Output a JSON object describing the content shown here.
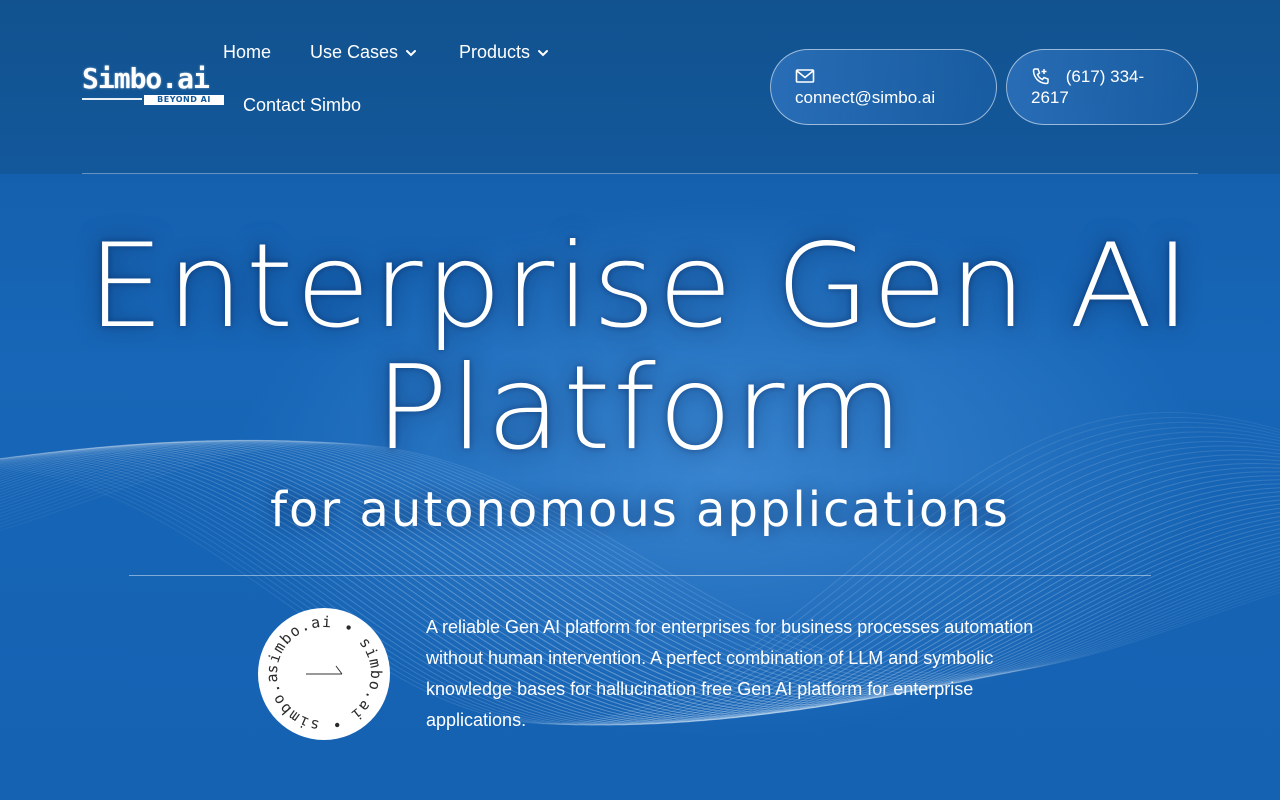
{
  "logo": {
    "wordmark": "Simbo.ai",
    "tagline": "BEYOND AI"
  },
  "nav": {
    "home": "Home",
    "use_cases": "Use Cases",
    "products": "Products",
    "contact": "Contact Simbo"
  },
  "contact": {
    "email": "connect@simbo.ai",
    "phone_line1": "(617) 334-",
    "phone_line2": "2617",
    "email_icon": "envelope-icon",
    "phone_icon": "phone-icon"
  },
  "hero": {
    "title_line1": "Enterprise Gen AI",
    "title_line2": "Platform",
    "subtitle": "for autonomous applications"
  },
  "badge": {
    "ring_text": "simbo.ai • simbo.ai • simbo.ai •",
    "icon": "arrow-right-icon"
  },
  "description": "A reliable Gen AI platform for enterprises for business processes automation without human intervention. A perfect combination of LLM and symbolic knowledge bases for hallucination free Gen AI platform for enterprise applications.",
  "colors": {
    "primary": "#1462b0",
    "header": "#11528f",
    "text": "#ffffff"
  }
}
